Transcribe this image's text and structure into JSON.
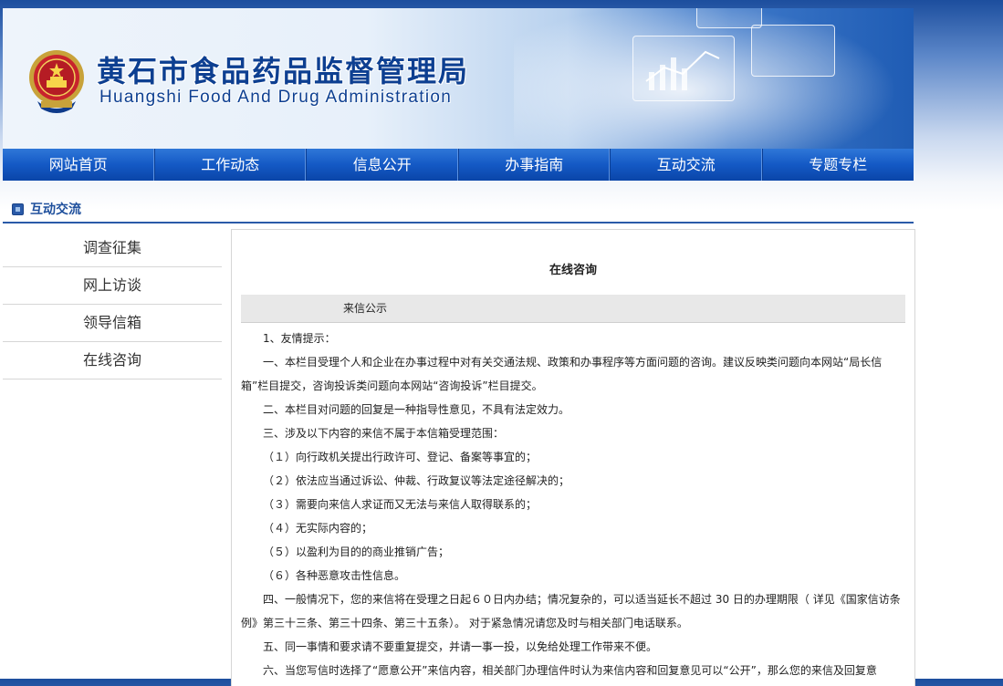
{
  "header": {
    "title_cn": "黄石市食品药品监督管理局",
    "title_en": "Huangshi Food And Drug Administration",
    "emblem_icon": "national-emblem-icon"
  },
  "nav": {
    "items": [
      {
        "label": "网站首页"
      },
      {
        "label": "工作动态"
      },
      {
        "label": "信息公开"
      },
      {
        "label": "办事指南"
      },
      {
        "label": "互动交流"
      },
      {
        "label": "专题专栏"
      }
    ]
  },
  "section": {
    "title": "互动交流"
  },
  "sidebar": {
    "items": [
      {
        "label": "调查征集"
      },
      {
        "label": "网上访谈"
      },
      {
        "label": "领导信箱"
      },
      {
        "label": "在线咨询"
      }
    ]
  },
  "main": {
    "title": "在线咨询",
    "tab_label": "来信公示",
    "paragraphs": [
      "1、友情提示：",
      "一、本栏目受理个人和企业在办事过程中对有关交通法规、政策和办事程序等方面问题的咨询。建议反映类问题向本网站“局长信箱”栏目提交，咨询投诉类问题向本网站“咨询投诉”栏目提交。",
      "二、本栏目对问题的回复是一种指导性意见，不具有法定效力。",
      "三、涉及以下内容的来信不属于本信箱受理范围：",
      "（１）向行政机关提出行政许可、登记、备案等事宜的；",
      "（２）依法应当通过诉讼、仲裁、行政复议等法定途径解决的；",
      "（３）需要向来信人求证而又无法与来信人取得联系的；",
      "（４）无实际内容的；",
      "（５）以盈利为目的的商业推销广告；",
      "（６）各种恶意攻击性信息。",
      "四、一般情况下，您的来信将在受理之日起６０日内办结；情况复杂的，可以适当延长不超过 30 日的办理期限（ 详见《国家信访条例》第三十三条、第三十四条、第三十五条）。 对于紧急情况请您及时与相关部门电话联系。",
      "五、同一事情和要求请不要重复提交，并请一事一投，以免给处理工作带来不便。",
      "六、当您写信时选择了“愿意公开”来信内容，相关部门办理信件时认为来信内容和回复意见可以“公开”，那么您的来信及回复意"
    ]
  }
}
